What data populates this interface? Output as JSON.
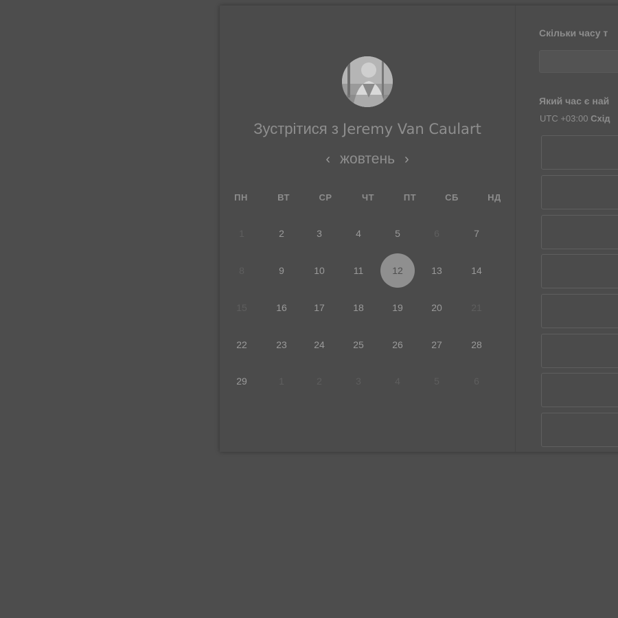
{
  "booking": {
    "title_prefix": "Зустрітися з",
    "host_name": "Jeremy Van Caulart",
    "month_label": "жовтень",
    "prev_icon": "chevron-left-icon",
    "next_icon": "chevron-right-icon",
    "weekdays": [
      "ПН",
      "ВТ",
      "СР",
      "ЧТ",
      "ПТ",
      "СБ",
      "НД"
    ],
    "weeks": [
      [
        {
          "d": "1",
          "m": true
        },
        {
          "d": "2"
        },
        {
          "d": "3"
        },
        {
          "d": "4"
        },
        {
          "d": "5"
        },
        {
          "d": "6",
          "m": true
        },
        {
          "d": "7"
        }
      ],
      [
        {
          "d": "8",
          "m": true
        },
        {
          "d": "9"
        },
        {
          "d": "10"
        },
        {
          "d": "11"
        },
        {
          "d": "12",
          "s": true
        },
        {
          "d": "13"
        },
        {
          "d": "14"
        }
      ],
      [
        {
          "d": "15",
          "m": true
        },
        {
          "d": "16"
        },
        {
          "d": "17"
        },
        {
          "d": "18"
        },
        {
          "d": "19"
        },
        {
          "d": "20"
        },
        {
          "d": "21",
          "m": true
        }
      ],
      [
        {
          "d": "22"
        },
        {
          "d": "23"
        },
        {
          "d": "24"
        },
        {
          "d": "25"
        },
        {
          "d": "26"
        },
        {
          "d": "27"
        },
        {
          "d": "28"
        }
      ],
      [
        {
          "d": "29"
        },
        {
          "d": "1",
          "m": true
        },
        {
          "d": "2",
          "m": true
        },
        {
          "d": "3",
          "m": true
        },
        {
          "d": "4",
          "m": true
        },
        {
          "d": "5",
          "m": true
        },
        {
          "d": "6",
          "m": true
        }
      ]
    ]
  },
  "right": {
    "duration_label": "Скільки часу т",
    "time_label": "Який час є най",
    "tz_prefix": "UTC +03:00",
    "tz_name": "Схід"
  },
  "colors": {
    "overlay_bg": "#4d4d4d",
    "selected_day": "#8f8f8f"
  }
}
